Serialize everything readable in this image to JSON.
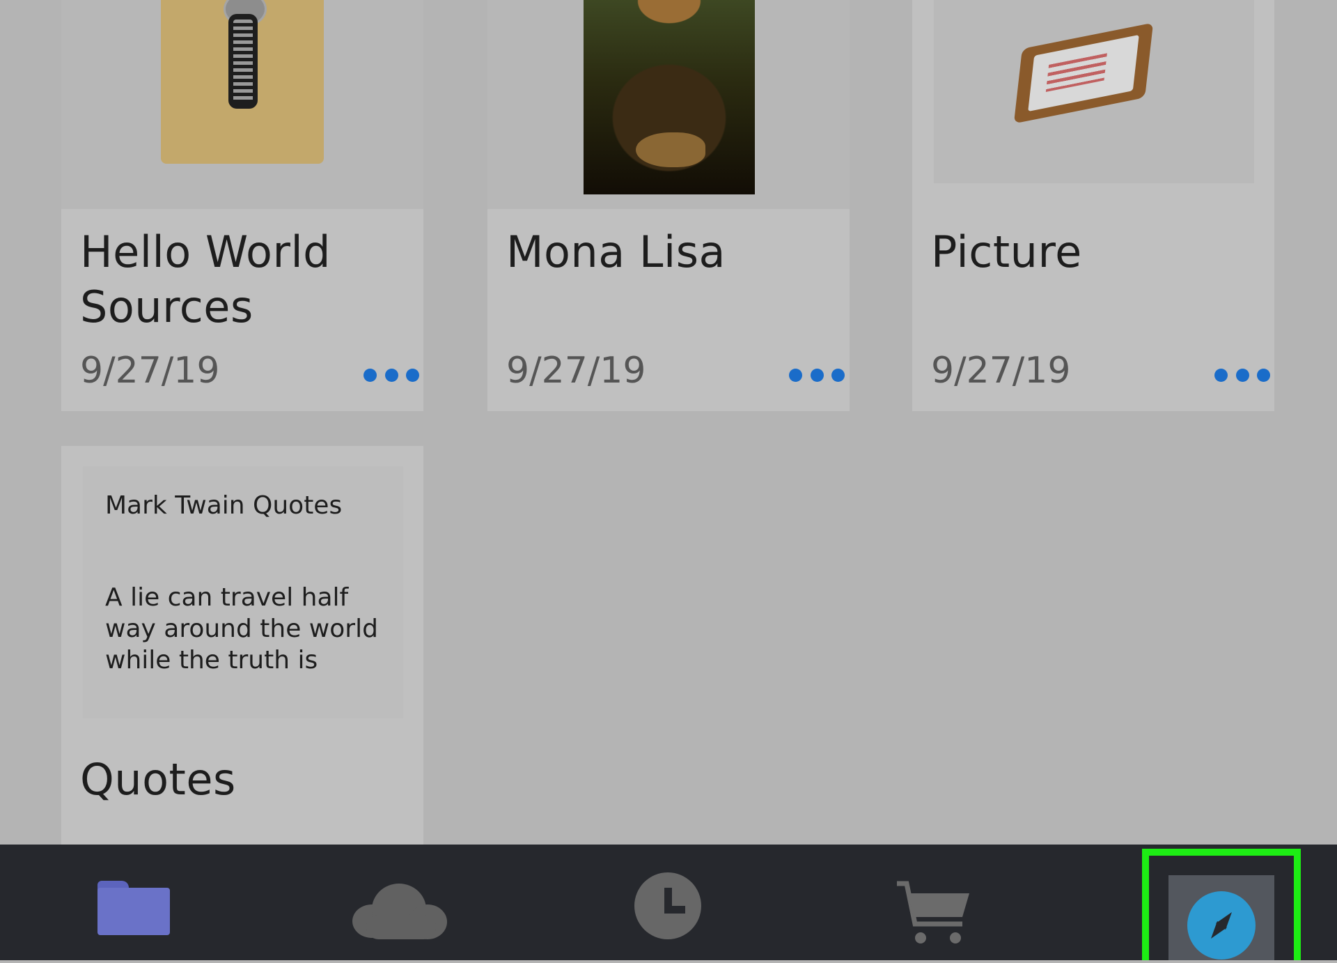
{
  "files": [
    {
      "title": "Hello World Sources",
      "title_lines": [
        "Hello World",
        "Sources"
      ],
      "date": "9/27/19",
      "thumbnail": "zip-archive-icon"
    },
    {
      "title": "Mona Lisa",
      "date": "9/27/19",
      "thumbnail": "mona-lisa-painting"
    },
    {
      "title": "Picture",
      "date": "9/27/19",
      "thumbnail": "picture-frame-icon"
    },
    {
      "title": "Quotes",
      "preview_title": "Mark Twain Quotes",
      "preview_lines": [
        "A lie can travel half",
        "way around the world",
        "while the truth is"
      ],
      "thumbnail": "text-document-preview"
    }
  ],
  "tabbar": {
    "tabs": [
      {
        "icon": "folder-icon",
        "color": "#6a72c8"
      },
      {
        "icon": "cloud-icon",
        "color": "#616161"
      },
      {
        "icon": "clock-icon",
        "color": "#676767"
      },
      {
        "icon": "cart-icon",
        "color": "#6b6b6b"
      },
      {
        "icon": "compass-icon",
        "color": "#2d9ad1",
        "selected": true
      }
    ],
    "highlight_color": "#1ded14"
  },
  "colors": {
    "accent": "#1a6cc9",
    "background": "#b4b4b4",
    "tabbar": "#26282d"
  }
}
